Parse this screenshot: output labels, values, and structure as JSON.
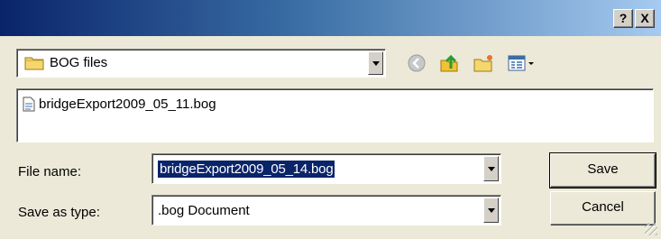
{
  "titlebar": {
    "help_label": "?",
    "close_label": "X"
  },
  "lookin": {
    "value": "BOG files"
  },
  "toolbar": {
    "back_icon": "back-arrow-icon",
    "up_icon": "up-folder-icon",
    "newfolder_icon": "new-folder-icon",
    "view_icon": "view-menu-icon"
  },
  "files": [
    {
      "name": "bridgeExport2009_05_11.bog",
      "icon": "document-icon"
    }
  ],
  "form": {
    "filename_label": "File name:",
    "filename_value": "bridgeExport2009_05_14.bog",
    "savetype_label": "Save as type:",
    "savetype_value": ".bog Document"
  },
  "buttons": {
    "save_label": "Save",
    "cancel_label": "Cancel"
  },
  "colors": {
    "title_start": "#0a246a",
    "title_end": "#a6caf0",
    "selection": "#0a246a",
    "face": "#ece9d8"
  }
}
